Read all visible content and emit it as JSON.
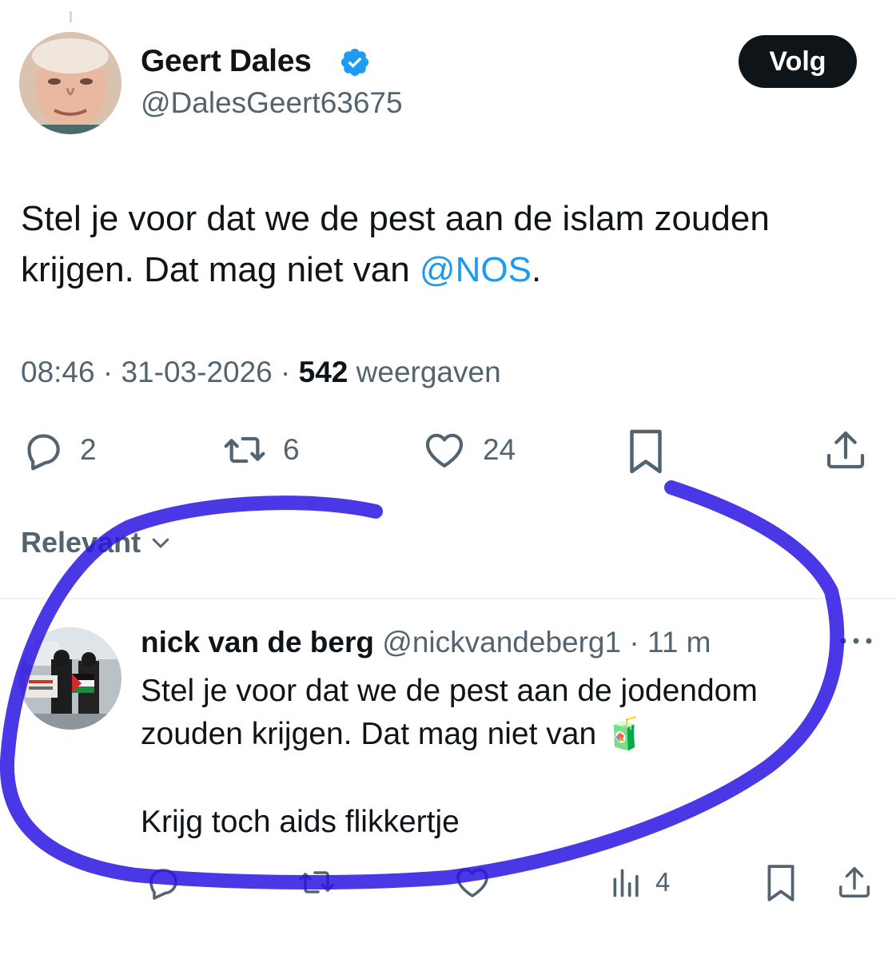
{
  "tweet": {
    "author_name": "Geert Dales",
    "author_handle": "@DalesGeert63675",
    "follow_label": "Volg",
    "text_before": "Stel je voor dat we de pest aan de islam zouden krijgen. Dat mag niet van ",
    "mention": "@NOS",
    "text_after": ".",
    "time": "08:46",
    "sep1": " · ",
    "date": "31-03-2026",
    "sep2": " · ",
    "views_count": "542",
    "views_label": " weergaven",
    "reply_count": "2",
    "retweet_count": "6",
    "like_count": "24"
  },
  "sort": {
    "label": "Relevant"
  },
  "reply": {
    "author_name": "nick van de berg",
    "author_handle": "@nickvandeberg1",
    "separator": " · ",
    "time": "11 m",
    "text_line": "Stel je voor dat we de pest aan de jodendom zouden krijgen. Dat mag niet van ",
    "emoji": "🧃",
    "text_line2": "Krijg toch aids flikkertje",
    "views_count": "4"
  },
  "colors": {
    "accent": "#1d9bf0",
    "text": "#0f1419",
    "muted": "#536471",
    "annotation": "#2a14e0"
  },
  "icons": [
    "verified-badge-icon",
    "reply-icon",
    "retweet-icon",
    "like-icon",
    "bookmark-icon",
    "share-icon",
    "chevron-down-icon",
    "more-icon",
    "views-icon"
  ]
}
